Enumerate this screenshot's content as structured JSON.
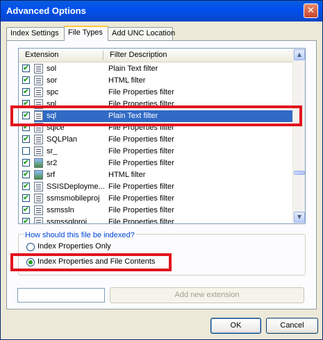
{
  "window": {
    "title": "Advanced Options",
    "close_glyph": "✕"
  },
  "tabs": [
    {
      "label": "Index Settings",
      "active": false
    },
    {
      "label": "File Types",
      "active": true
    },
    {
      "label": "Add UNC Location",
      "active": false
    }
  ],
  "file_list": {
    "columns": [
      "Extension",
      "Filter Description"
    ],
    "rows": [
      {
        "ext": "sol",
        "desc": "Plain Text filter",
        "checked": true,
        "icon": "text-file-icon"
      },
      {
        "ext": "sor",
        "desc": "HTML filter",
        "checked": true,
        "icon": "text-file-icon"
      },
      {
        "ext": "spc",
        "desc": "File Properties filter",
        "checked": true,
        "icon": "certificate-file-icon"
      },
      {
        "ext": "spl",
        "desc": "File Properties filter",
        "checked": true,
        "icon": "text-file-icon"
      },
      {
        "ext": "sql",
        "desc": "Plain Text filter",
        "checked": true,
        "icon": "text-file-icon",
        "selected": true
      },
      {
        "ext": "sqlce",
        "desc": "File Properties filter",
        "checked": true,
        "icon": "text-file-icon"
      },
      {
        "ext": "SQLPlan",
        "desc": "File Properties filter",
        "checked": true,
        "icon": "text-file-icon"
      },
      {
        "ext": "sr_",
        "desc": "File Properties filter",
        "checked": false,
        "icon": "text-file-icon"
      },
      {
        "ext": "sr2",
        "desc": "File Properties filter",
        "checked": true,
        "icon": "image-file-icon"
      },
      {
        "ext": "srf",
        "desc": "HTML filter",
        "checked": true,
        "icon": "image-file-icon"
      },
      {
        "ext": "SSISDeployme...",
        "desc": "File Properties filter",
        "checked": true,
        "icon": "text-file-icon"
      },
      {
        "ext": "ssmsmobileproj",
        "desc": "File Properties filter",
        "checked": true,
        "icon": "text-file-icon"
      },
      {
        "ext": "ssmssln",
        "desc": "File Properties filter",
        "checked": true,
        "icon": "text-file-icon"
      },
      {
        "ext": "ssmssqlproj",
        "desc": "File Properties filter",
        "checked": true,
        "icon": "text-file-icon"
      }
    ],
    "check_glyph": "✔",
    "scroll_up_glyph": "▲",
    "scroll_down_glyph": "▼"
  },
  "index_group": {
    "question": "How should this file be indexed?",
    "options": [
      {
        "label": "Index Properties Only",
        "selected": false
      },
      {
        "label": "Index Properties and File Contents",
        "selected": true
      }
    ]
  },
  "add_extension": {
    "input_value": "",
    "button_label": "Add new extension"
  },
  "footer": {
    "ok_label": "OK",
    "cancel_label": "Cancel"
  },
  "colors": {
    "highlight": "#e1141e",
    "selection": "#316ac5",
    "title_bar": "#0050ee"
  }
}
